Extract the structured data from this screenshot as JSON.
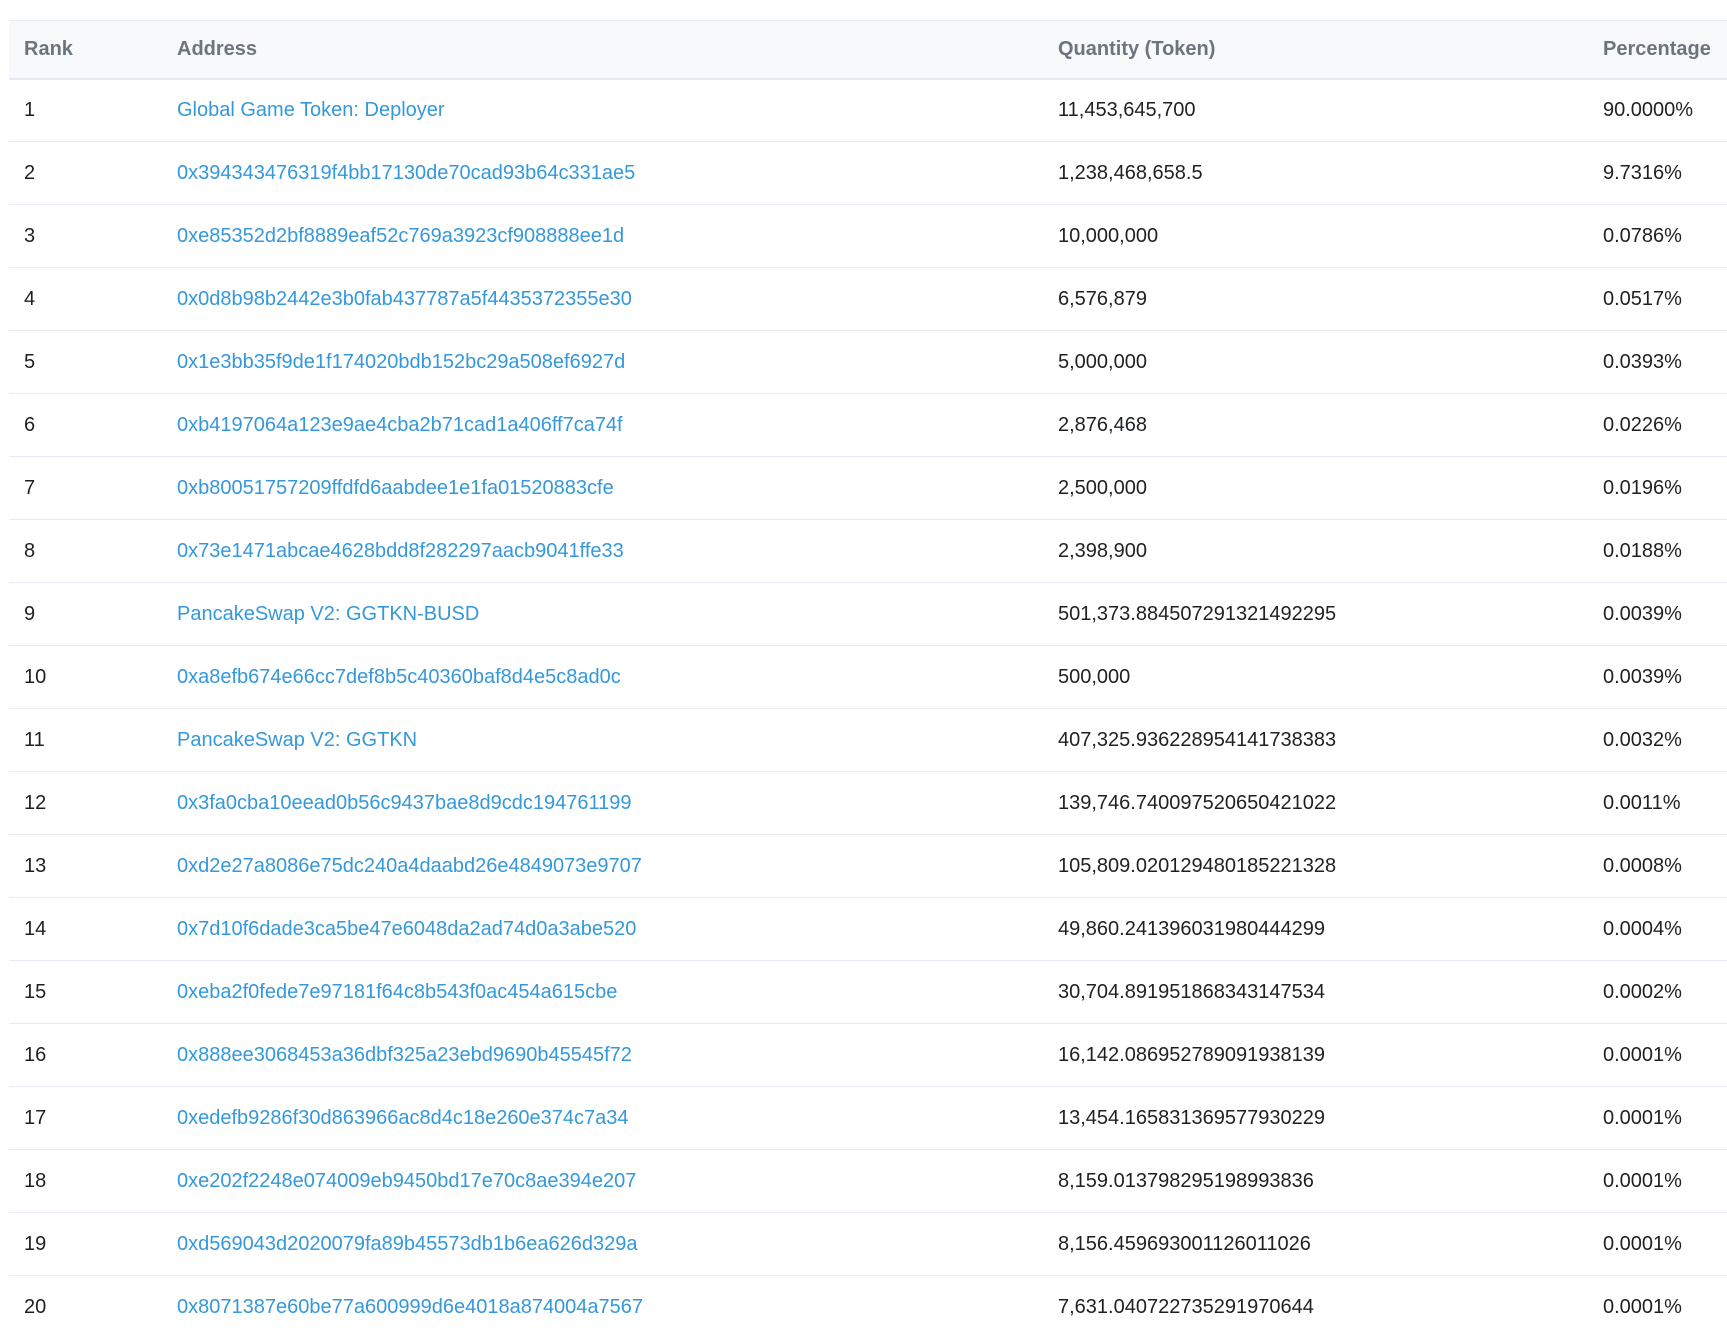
{
  "table": {
    "headers": {
      "rank": "Rank",
      "address": "Address",
      "quantity": "Quantity (Token)",
      "percentage": "Percentage"
    },
    "rows": [
      {
        "rank": "1",
        "address": "Global Game Token: Deployer",
        "quantity": "11,453,645,700",
        "percentage": "90.0000%"
      },
      {
        "rank": "2",
        "address": "0x394343476319f4bb17130de70cad93b64c331ae5",
        "quantity": "1,238,468,658.5",
        "percentage": "9.7316%"
      },
      {
        "rank": "3",
        "address": "0xe85352d2bf8889eaf52c769a3923cf908888ee1d",
        "quantity": "10,000,000",
        "percentage": "0.0786%"
      },
      {
        "rank": "4",
        "address": "0x0d8b98b2442e3b0fab437787a5f4435372355e30",
        "quantity": "6,576,879",
        "percentage": "0.0517%"
      },
      {
        "rank": "5",
        "address": "0x1e3bb35f9de1f174020bdb152bc29a508ef6927d",
        "quantity": "5,000,000",
        "percentage": "0.0393%"
      },
      {
        "rank": "6",
        "address": "0xb4197064a123e9ae4cba2b71cad1a406ff7ca74f",
        "quantity": "2,876,468",
        "percentage": "0.0226%"
      },
      {
        "rank": "7",
        "address": "0xb80051757209ffdfd6aabdee1e1fa01520883cfe",
        "quantity": "2,500,000",
        "percentage": "0.0196%"
      },
      {
        "rank": "8",
        "address": "0x73e1471abcae4628bdd8f282297aacb9041ffe33",
        "quantity": "2,398,900",
        "percentage": "0.0188%"
      },
      {
        "rank": "9",
        "address": "PancakeSwap V2: GGTKN-BUSD",
        "quantity": "501,373.884507291321492295",
        "percentage": "0.0039%"
      },
      {
        "rank": "10",
        "address": "0xa8efb674e66cc7def8b5c40360baf8d4e5c8ad0c",
        "quantity": "500,000",
        "percentage": "0.0039%"
      },
      {
        "rank": "11",
        "address": "PancakeSwap V2: GGTKN",
        "quantity": "407,325.936228954141738383",
        "percentage": "0.0032%"
      },
      {
        "rank": "12",
        "address": "0x3fa0cba10eead0b56c9437bae8d9cdc194761199",
        "quantity": "139,746.740097520650421022",
        "percentage": "0.0011%"
      },
      {
        "rank": "13",
        "address": "0xd2e27a8086e75dc240a4daabd26e4849073e9707",
        "quantity": "105,809.020129480185221328",
        "percentage": "0.0008%"
      },
      {
        "rank": "14",
        "address": "0x7d10f6dade3ca5be47e6048da2ad74d0a3abe520",
        "quantity": "49,860.241396031980444299",
        "percentage": "0.0004%"
      },
      {
        "rank": "15",
        "address": "0xeba2f0fede7e97181f64c8b543f0ac454a615cbe",
        "quantity": "30,704.891951868343147534",
        "percentage": "0.0002%"
      },
      {
        "rank": "16",
        "address": "0x888ee3068453a36dbf325a23ebd9690b45545f72",
        "quantity": "16,142.086952789091938139",
        "percentage": "0.0001%"
      },
      {
        "rank": "17",
        "address": "0xedefb9286f30d863966ac8d4c18e260e374c7a34",
        "quantity": "13,454.165831369577930229",
        "percentage": "0.0001%"
      },
      {
        "rank": "18",
        "address": "0xe202f2248e074009eb9450bd17e70c8ae394e207",
        "quantity": "8,159.013798295198993836",
        "percentage": "0.0001%"
      },
      {
        "rank": "19",
        "address": "0xd569043d2020079fa89b45573db1b6ea626d329a",
        "quantity": "8,156.459693001126011026",
        "percentage": "0.0001%"
      },
      {
        "rank": "20",
        "address": "0x8071387e60be77a600999d6e4018a874004a7567",
        "quantity": "7,631.040722735291970644",
        "percentage": "0.0001%"
      }
    ]
  },
  "colors": {
    "link": "#3498db",
    "header_text": "#6c757e",
    "header_bg": "#f8f9fa",
    "row_border": "#e7eaf3",
    "body_text": "#1e2022"
  }
}
